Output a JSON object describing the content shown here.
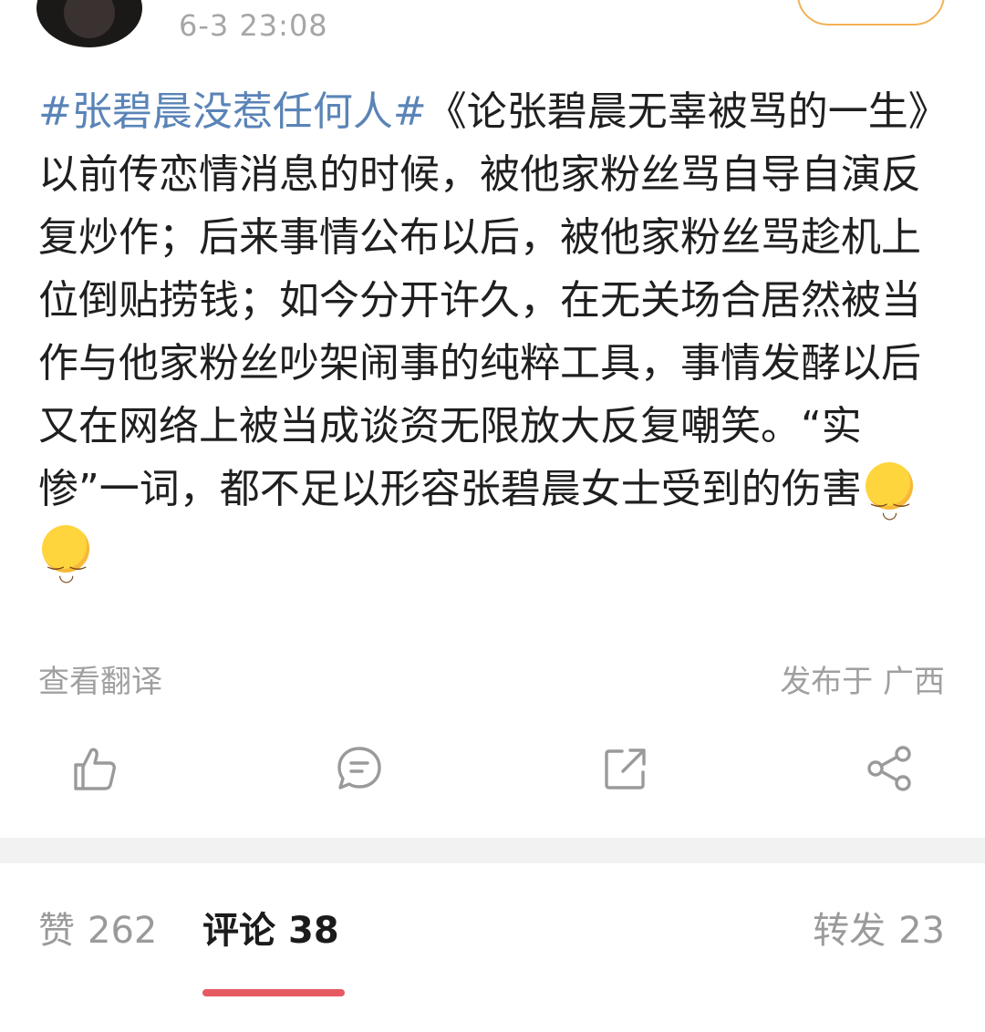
{
  "header": {
    "timestamp": "6-3 23:08"
  },
  "post": {
    "hashtag": "#张碧晨没惹任何人#",
    "title": "《论张碧晨无辜被骂的一生》",
    "body": "以前传恋情消息的时候，被他家粉丝骂自导自演反复炒作；后来事情公布以后，被他家粉丝骂趁机上位倒贴捞钱；如今分开许久，在无关场合居然被当作与他家粉丝吵架闹事的纯粹工具，事情发酵以后又在网络上被当成谈资无限放大反复嘲笑。“实惨”一词，都不足以形容张碧晨女士受到的伤害",
    "emojis": [
      "smile-emoji",
      "smile-emoji"
    ]
  },
  "meta": {
    "translate_label": "查看翻译",
    "location": "发布于 广西"
  },
  "actions": [
    {
      "icon": "thumbs-up-icon"
    },
    {
      "icon": "comment-icon"
    },
    {
      "icon": "repost-icon"
    },
    {
      "icon": "share-icon"
    }
  ],
  "tabs": [
    {
      "label": "赞",
      "count": "262",
      "active": false
    },
    {
      "label": "评论",
      "count": "38",
      "active": true
    },
    {
      "label": "转发",
      "count": "23",
      "active": false
    }
  ],
  "colors": {
    "hashtag": "#5a84b7",
    "accent_underline": "#e65a62",
    "follow_border": "#f3b157"
  }
}
